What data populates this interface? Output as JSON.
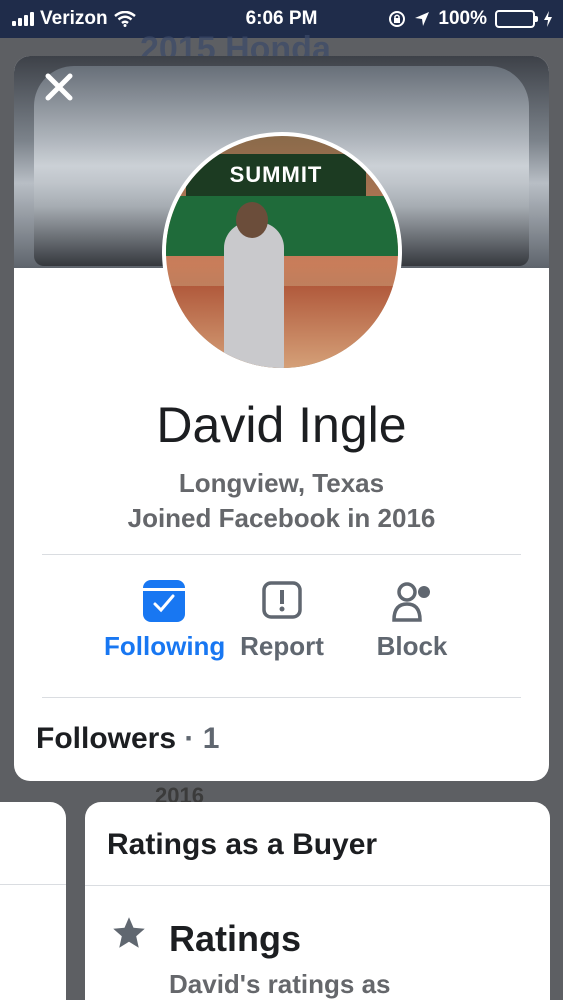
{
  "status_bar": {
    "carrier": "Verizon",
    "time": "6:06 PM",
    "battery": "100%"
  },
  "background": {
    "title": "2015 Honda",
    "year": "2016"
  },
  "profile": {
    "name": "David Ingle",
    "location": "Longview, Texas",
    "joined": "Joined Facebook in 2016",
    "avatar_sign": "SUMMIT"
  },
  "actions": {
    "following": {
      "label": "Following",
      "icon": "following-icon"
    },
    "report": {
      "label": "Report",
      "icon": "report-icon"
    },
    "block": {
      "label": "Block",
      "icon": "block-icon"
    }
  },
  "followers": {
    "label": "Followers",
    "separator": "·",
    "count": "1"
  },
  "ratings_card": {
    "heading": "Ratings as a Buyer",
    "title": "Ratings",
    "subtitle": "David's ratings as"
  },
  "colors": {
    "accent": "#1877f2",
    "muted": "#606770"
  }
}
